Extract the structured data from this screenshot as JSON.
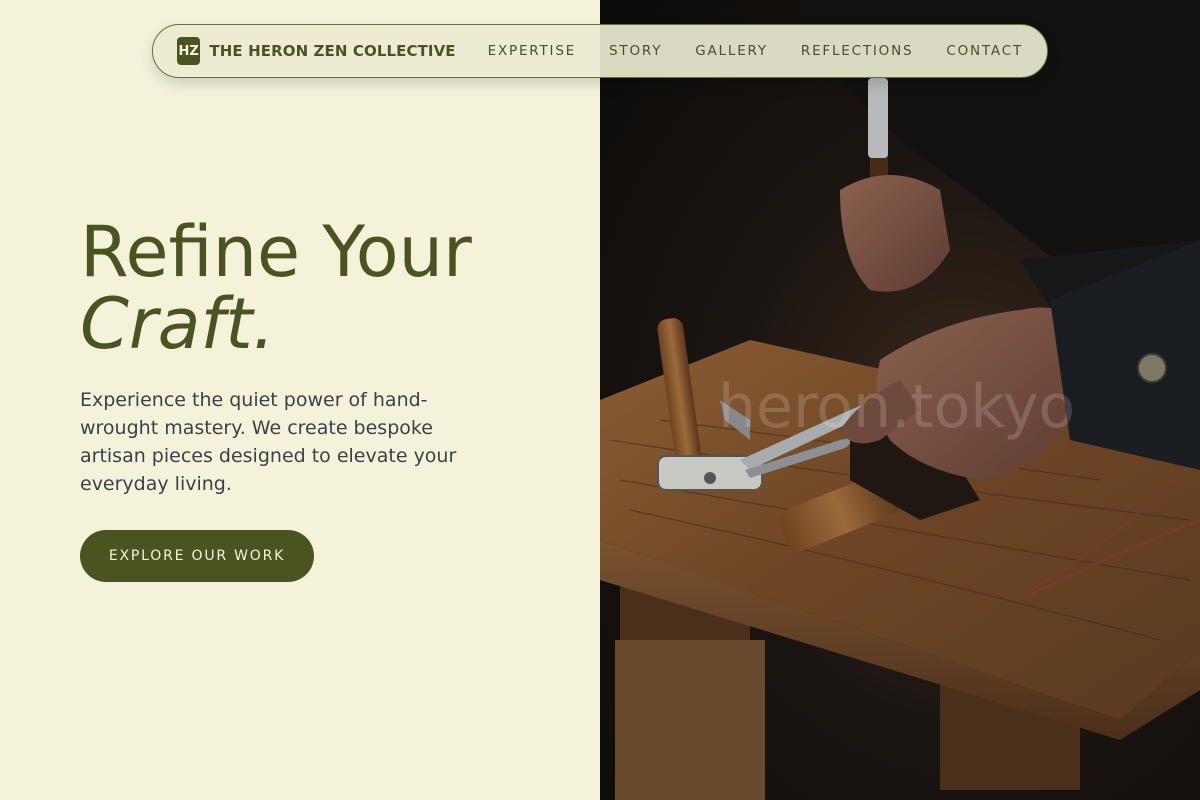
{
  "nav": {
    "logo_badge": "HZ",
    "brand": "THE HERON ZEN COLLECTIVE",
    "links": [
      {
        "label": "EXPERTISE"
      },
      {
        "label": "STORY"
      },
      {
        "label": "GALLERY"
      },
      {
        "label": "REFLECTIONS"
      },
      {
        "label": "CONTACT"
      }
    ]
  },
  "hero": {
    "title_line1": "Refine Your",
    "title_line2": "Craft.",
    "description": "Experience the quiet power of hand-wrought mastery. We create bespoke artisan pieces designed to elevate your everyday living.",
    "cta_label": "EXPLORE OUR WORK"
  },
  "image": {
    "watermark": "heron.tokyo",
    "subject": "artisan-hands-with-tools-on-workbench"
  },
  "colors": {
    "background": "#f4f3da",
    "accent": "#4a5420",
    "text": "#3c4148"
  }
}
